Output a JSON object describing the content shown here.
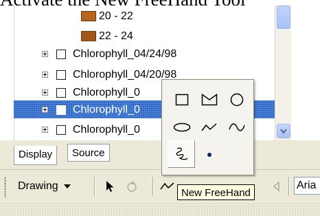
{
  "header": {
    "text": "Activate the New FreeHand Tool"
  },
  "legend": {
    "ranges": [
      {
        "label": "20 - 22",
        "color": "#b5651d"
      },
      {
        "label": "22 - 24",
        "color": "#b5651d"
      }
    ]
  },
  "layers": [
    {
      "label": "Chlorophyll_04/24/98",
      "selected": false
    },
    {
      "label": "Chlorophyll_04/20/98",
      "selected": false
    },
    {
      "label": "Chlorophyll_0",
      "selected": false
    },
    {
      "label": "Chlorophyll_0",
      "selected": true
    },
    {
      "label": "Chlorophyll_0",
      "selected": false
    }
  ],
  "tabs": [
    {
      "label": "Display",
      "active": true
    },
    {
      "label": "Source",
      "active": false
    }
  ],
  "toolbar": {
    "drawing_label": "Drawing",
    "font_value": "Aria"
  },
  "palette": {
    "tools": [
      "rectangle-tool",
      "polygon-tool",
      "circle-tool",
      "ellipse-tool",
      "line-tool",
      "curve-tool",
      "freehand-tool",
      "marker-tool"
    ]
  },
  "tooltip": {
    "text": "New FreeHand"
  },
  "colors": {
    "selection": "#316ac5",
    "chrome": "#ece9d8",
    "tooltip_bg": "#ffffe1"
  }
}
